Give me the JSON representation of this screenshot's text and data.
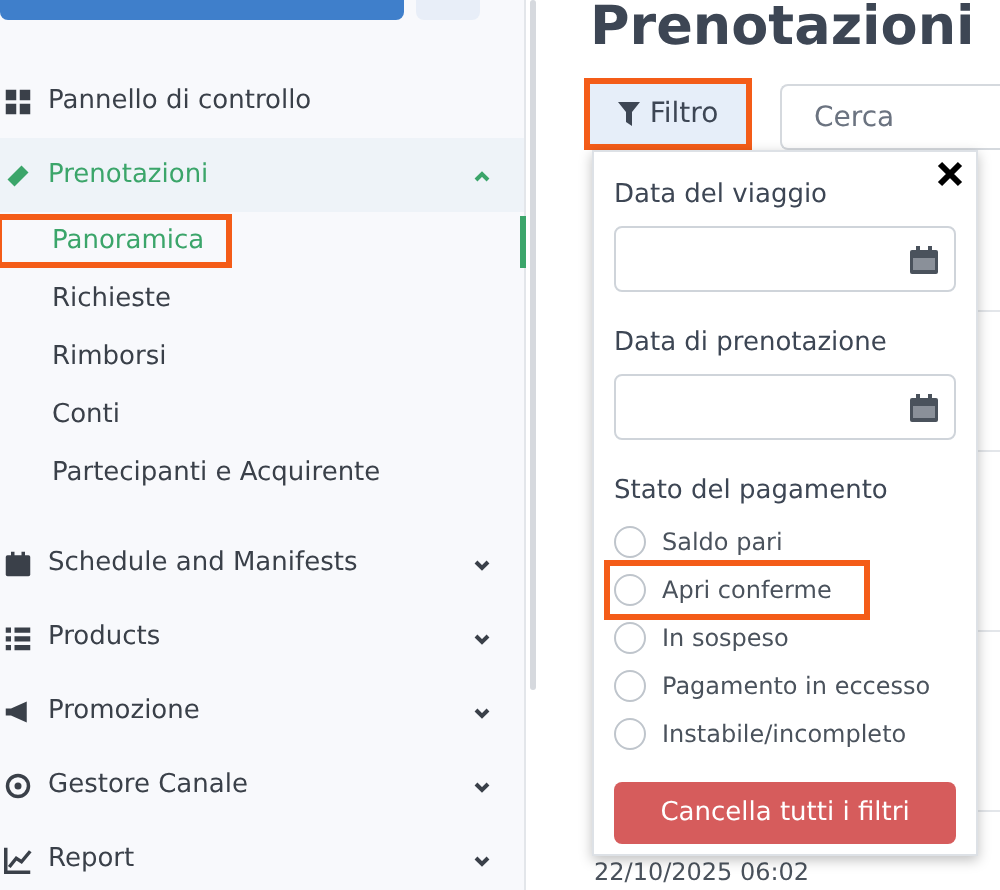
{
  "sidebar": {
    "items": [
      {
        "kind": "link",
        "label": "Pannello di controllo"
      },
      {
        "kind": "group",
        "label": "Prenotazioni",
        "expanded": true,
        "selected": true,
        "children": [
          {
            "label": "Panoramica",
            "selected": true,
            "highlighted": true
          },
          {
            "label": "Richieste",
            "selected": false,
            "highlighted": false
          },
          {
            "label": "Rimborsi",
            "selected": false,
            "highlighted": false
          },
          {
            "label": "Conti",
            "selected": false,
            "highlighted": false
          },
          {
            "label": "Partecipanti e Acquirente",
            "selected": false,
            "highlighted": false
          }
        ]
      },
      {
        "kind": "group",
        "label": "Schedule and Manifests",
        "expanded": false,
        "selected": false
      },
      {
        "kind": "group",
        "label": "Products",
        "expanded": false,
        "selected": false
      },
      {
        "kind": "group",
        "label": "Promozione",
        "expanded": false,
        "selected": false
      },
      {
        "kind": "group",
        "label": "Gestore Canale",
        "expanded": false,
        "selected": false
      },
      {
        "kind": "group",
        "label": "Report",
        "expanded": false,
        "selected": false
      }
    ]
  },
  "page": {
    "title": "Prenotazioni",
    "filter_button": {
      "label": "Filtro",
      "highlighted": true
    },
    "search": {
      "placeholder": "Cerca"
    }
  },
  "table": {
    "rows": [
      {
        "date": "22/10/2025 06:02"
      }
    ]
  },
  "filter_panel": {
    "fields": [
      {
        "label": "Data del viaggio"
      },
      {
        "label": "Data di prenotazione"
      }
    ],
    "payment_status": {
      "label": "Stato del pagamento",
      "options": [
        {
          "label": "Saldo pari",
          "selected": false,
          "highlighted": false
        },
        {
          "label": "Apri conferme",
          "selected": false,
          "highlighted": true
        },
        {
          "label": "In sospeso",
          "selected": false,
          "highlighted": false
        },
        {
          "label": "Pagamento in eccesso",
          "selected": false,
          "highlighted": false
        },
        {
          "label": "Instabile/incompleto",
          "selected": false,
          "highlighted": false
        }
      ]
    },
    "clear_button": "Cancella tutti i filtri"
  }
}
